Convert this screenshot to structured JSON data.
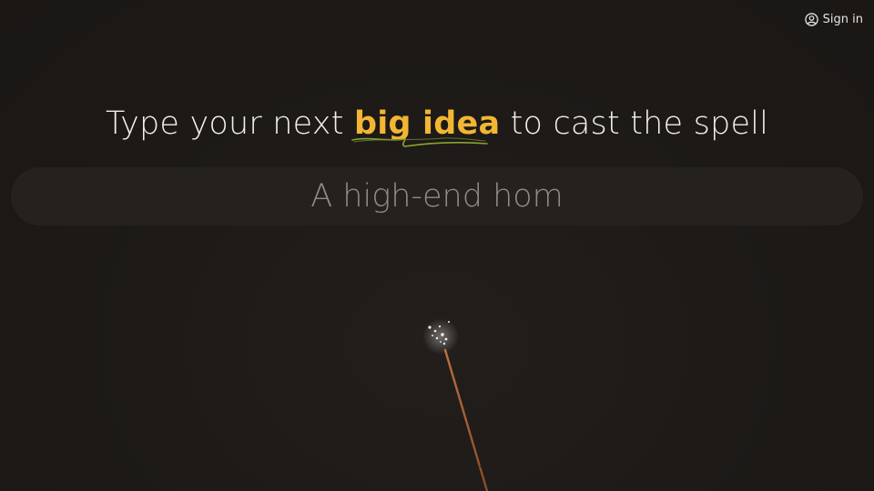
{
  "header": {
    "signin_label": "Sign in",
    "signin_icon": "user-circle-icon"
  },
  "hero": {
    "text_before": "Type your next ",
    "highlight": "big idea",
    "text_after": " to cast the spell"
  },
  "idea_input": {
    "value": "A high-end hom",
    "placeholder": ""
  },
  "colors": {
    "background": "#1c1917",
    "highlight": "#f2b633",
    "underline_green": "#8aa332",
    "wand": "#b5693a"
  }
}
